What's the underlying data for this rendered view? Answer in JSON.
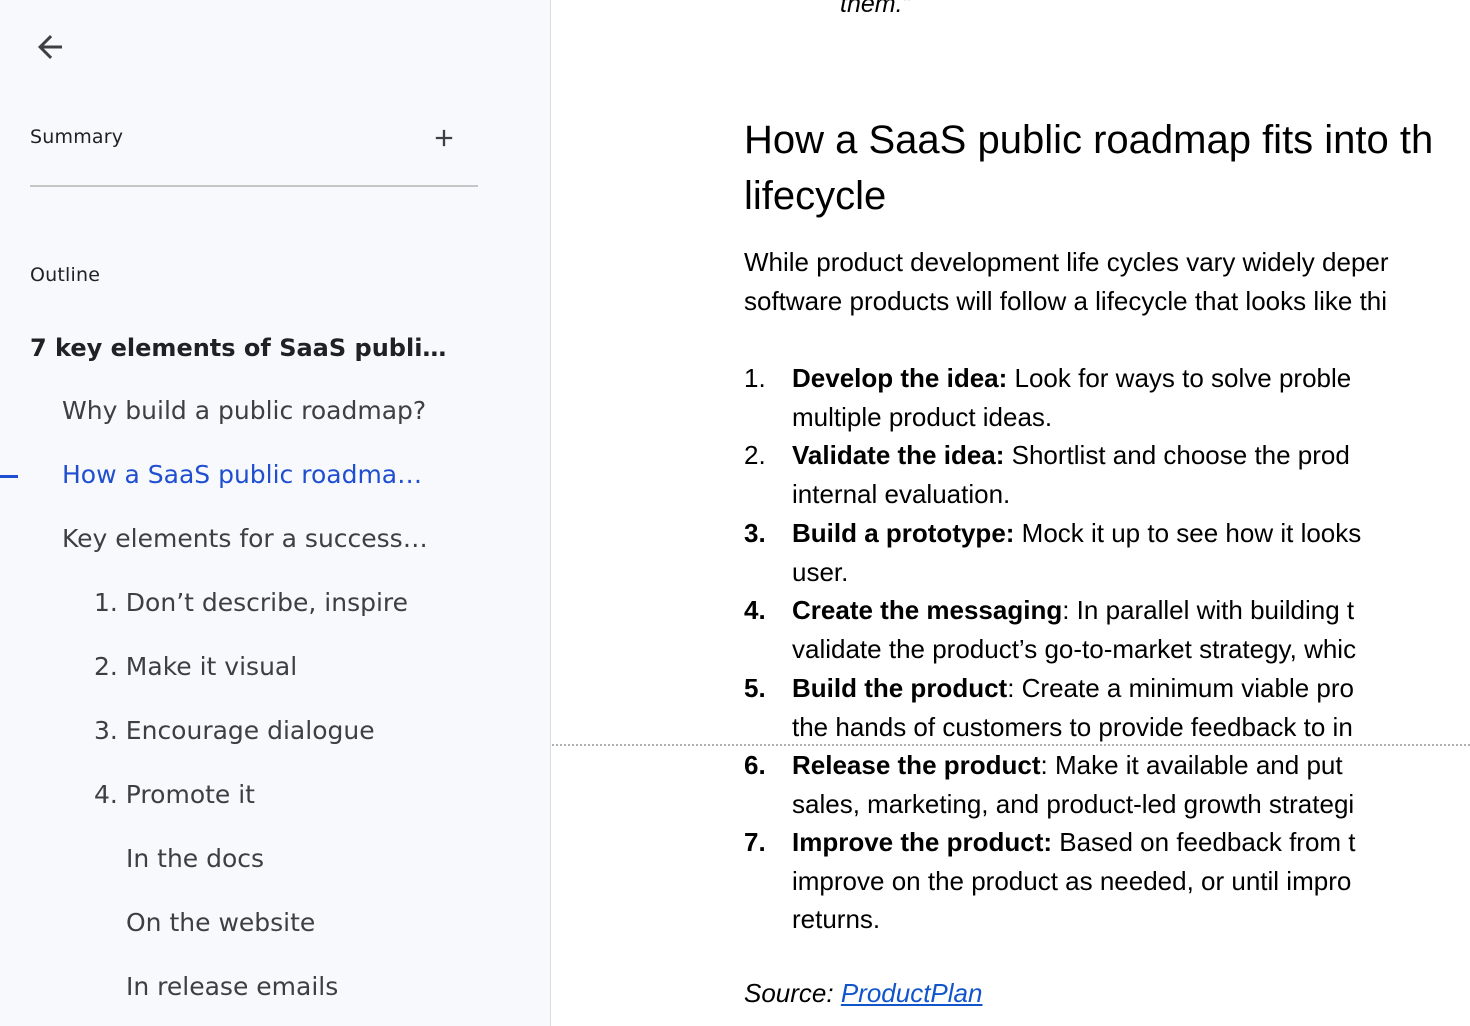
{
  "sidebar": {
    "summary_label": "Summary",
    "outline_label": "Outline",
    "items": [
      {
        "label": "7 key elements of SaaS publi…",
        "level": 0
      },
      {
        "label": "Why build a public roadmap?",
        "level": 1
      },
      {
        "label": "How a SaaS public roadma…",
        "level": 1,
        "active": true
      },
      {
        "label": "Key elements for a success…",
        "level": 1
      },
      {
        "label": "1. Don’t describe, inspire",
        "level": 2
      },
      {
        "label": "2. Make it visual",
        "level": 2
      },
      {
        "label": "3. Encourage dialogue",
        "level": 2
      },
      {
        "label": "4. Promote it",
        "level": 2
      },
      {
        "label": "In the docs",
        "level": 3
      },
      {
        "label": "On the website",
        "level": 3
      },
      {
        "label": "In release emails",
        "level": 3
      }
    ]
  },
  "document": {
    "quote_tail": "them.”",
    "heading_line1": "How a SaaS public roadmap fits into th",
    "heading_line2": "lifecycle",
    "para_line1": "While product development life cycles vary widely deper",
    "para_line2": "software products will follow a lifecycle that looks like thi",
    "list": [
      {
        "num": "1.",
        "term": "Develop the idea:",
        "rest": " Look for ways to solve proble",
        "line2": "multiple product ideas."
      },
      {
        "num": "2.",
        "term": "Validate the idea:",
        "rest": " Shortlist and choose the prod",
        "line2": "internal evaluation."
      },
      {
        "num": "3.",
        "term": "Build a prototype:",
        "rest": " Mock it up to see how it looks",
        "line2": "user."
      },
      {
        "num": "4.",
        "term": "Create the messaging",
        "rest": ": In parallel with building t",
        "line2": "validate the product’s go-to-market strategy, whic"
      },
      {
        "num": "5.",
        "term": "Build the product",
        "rest": ": Create a minimum viable pro",
        "line2": "the hands of customers to provide feedback to in"
      },
      {
        "num": "6.",
        "term": "Release the product",
        "rest": ": Make it available and put",
        "line2": "sales, marketing, and product-led growth strategi"
      },
      {
        "num": "7.",
        "term": "Improve the product:",
        "rest": " Based on feedback from t",
        "line2": "improve on the product as needed, or until impro",
        "line3": "returns."
      }
    ],
    "source_label": "Source: ",
    "source_link": "ProductPlan"
  },
  "colors": {
    "active_outline": "#1f4fcf",
    "link": "#1155cc",
    "sidebar_bg": "#f8f9fc"
  }
}
